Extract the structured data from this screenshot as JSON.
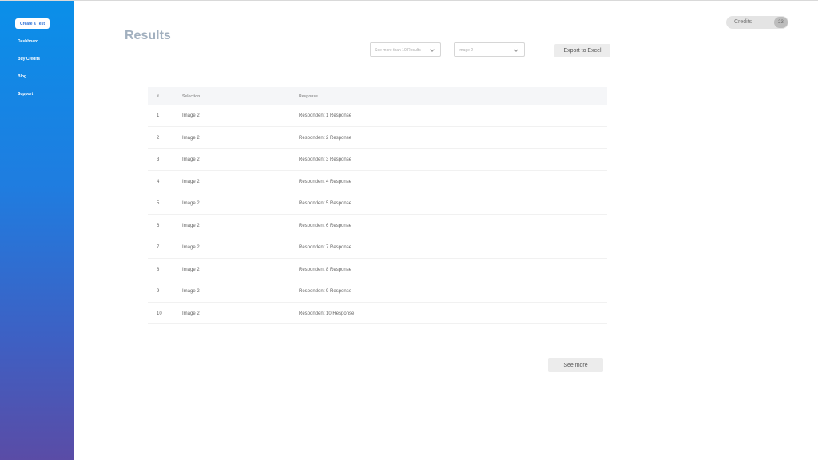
{
  "sidebar": {
    "create_label": "Create a Test",
    "items": [
      {
        "label": "Dashboard"
      },
      {
        "label": "Buy Credits"
      },
      {
        "label": "Blog"
      },
      {
        "label": "Support"
      }
    ]
  },
  "header": {
    "title": "Results",
    "credits_label": "Credits",
    "credits_count": "23"
  },
  "filters": {
    "results_select": "See more than 10 Results",
    "image_select": "Image 2",
    "export_label": "Export to Excel"
  },
  "table": {
    "headers": [
      "#",
      "Selection",
      "Response"
    ],
    "rows": [
      [
        "1",
        "Image 2",
        "Respondent 1 Response"
      ],
      [
        "2",
        "Image 2",
        "Respondent 2 Response"
      ],
      [
        "3",
        "Image 2",
        "Respondent 3 Response"
      ],
      [
        "4",
        "Image 2",
        "Respondent 4 Response"
      ],
      [
        "5",
        "Image 2",
        "Respondent 5 Response"
      ],
      [
        "6",
        "Image 2",
        "Respondent 6 Response"
      ],
      [
        "7",
        "Image 2",
        "Respondent 7 Response"
      ],
      [
        "8",
        "Image 2",
        "Respondent 8 Response"
      ],
      [
        "9",
        "Image 2",
        "Respondent 9 Response"
      ],
      [
        "10",
        "Image 2",
        "Respondent 10 Response"
      ]
    ]
  },
  "footer": {
    "see_more_label": "See more"
  },
  "colors": {
    "sidebar_top": "#0a8fe9",
    "sidebar_bottom": "#5a4ca6",
    "title": "#a2b0bf"
  }
}
